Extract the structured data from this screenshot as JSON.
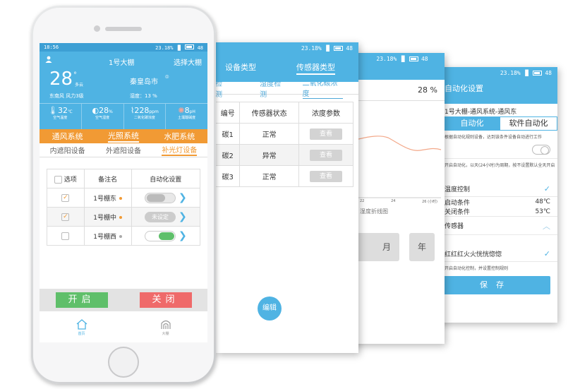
{
  "phone": {
    "status": {
      "time": "18:56",
      "signal": "23.18%",
      "battery": "48"
    },
    "title": "1号大棚",
    "select_label": "选择大棚",
    "weather": {
      "temp": "28",
      "degree": "°",
      "condition": "多云",
      "city": "秦皇岛市",
      "wind": "东南风  风力3级",
      "humidity": "湿度：13 %"
    },
    "sensors": [
      {
        "value": "32",
        "unit": "℃",
        "label": "空气温度"
      },
      {
        "value": "28",
        "unit": "%",
        "label": "空气湿度"
      },
      {
        "value": "228",
        "unit": "ppm",
        "label": "二氧化碳浓度"
      },
      {
        "value": "8",
        "unit": "pH",
        "label": "土壤酸碱度"
      }
    ],
    "system_tabs": [
      "通风系统",
      "光照系统",
      "水肥系统"
    ],
    "sub_tabs": [
      "内遮阳设备",
      "外遮阳设备",
      "补光灯设备"
    ],
    "table": {
      "headers": [
        "选项",
        "备注名",
        "自动化设置"
      ],
      "rows": [
        {
          "name": "1号棚东",
          "setting": ""
        },
        {
          "name": "1号棚中",
          "setting": "未设定"
        },
        {
          "name": "1号棚西",
          "setting": ""
        }
      ]
    },
    "open_label": "开启",
    "close_label": "关闭",
    "nav": [
      {
        "label": "首页"
      },
      {
        "label": "大棚"
      }
    ]
  },
  "screen2": {
    "status": {
      "signal": "23.18%",
      "battery": "48"
    },
    "tabs": [
      "设备类型",
      "传感器类型"
    ],
    "sub_tabs": [
      "检测",
      "湿度检测",
      "二氧化碳浓度"
    ],
    "headers": [
      "编号",
      "传感器状态",
      "浓度参数"
    ],
    "rows": [
      {
        "id": "碳1",
        "status": "正常",
        "action": "查看"
      },
      {
        "id": "碳2",
        "status": "异常",
        "action": "查看"
      },
      {
        "id": "碳3",
        "status": "正常",
        "action": "查看"
      }
    ],
    "edit_label": "编辑"
  },
  "screen3": {
    "status": {
      "signal": "23.18%",
      "battery": "48"
    },
    "value": "28 %",
    "x_ticks": [
      "22",
      "24",
      "26 (小时)"
    ],
    "chart_label": "湿度折线图",
    "buttons": [
      "月",
      "年"
    ]
  },
  "screen4": {
    "status": {
      "signal": "23.18%",
      "battery": "48"
    },
    "title": "自动化设置",
    "subtitle": "1号大棚-通风系统-通风东",
    "tabs": [
      "自动化",
      "软件自动化"
    ],
    "note1": "根据自动化规则设备，达到该条件设备自动进行工作",
    "note2": "开启自动化，以天(24小时)为周期，按不设置默认全天开启",
    "control_label": "温度控制",
    "cond1": {
      "label": "启动条件",
      "value": "48℃"
    },
    "cond2": {
      "label": "关闭条件",
      "value": "53℃"
    },
    "sensor_label": "传感器",
    "option": "红红红火火恍恍惚惚",
    "note3": "开启自动化控制，并设置控制规则",
    "save_label": "保存"
  }
}
